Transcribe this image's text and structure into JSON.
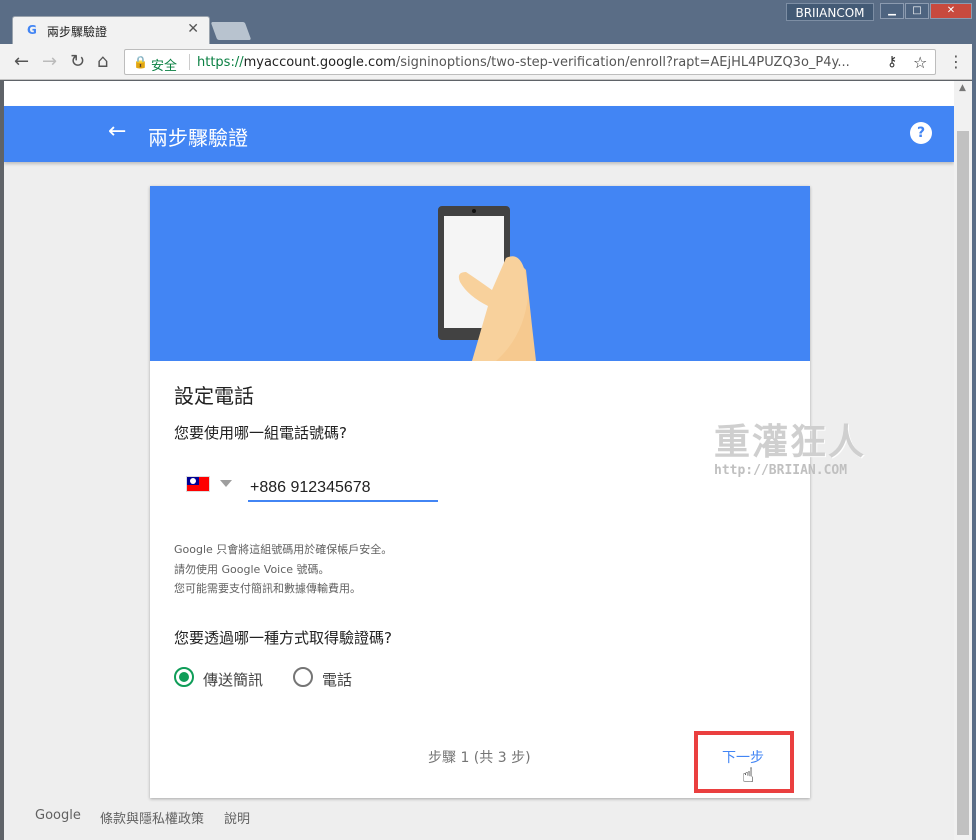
{
  "browser": {
    "tab_title": "兩步驟驗證",
    "tab_icon": "G",
    "user_badge": "BRIIANCOM",
    "secure_label": "安全",
    "url_scheme": "https://",
    "url_host": "myaccount.google.com",
    "url_path": "/signinoptions/two-step-verification/enroll?rapt=AEjHL4PUZQ3o_P4y..."
  },
  "appbar": {
    "title": "兩步驟驗證",
    "help": "?"
  },
  "form": {
    "section_title": "設定電話",
    "question_phone": "您要使用哪一組電話號碼?",
    "phone_value": "+886 912345678",
    "notes": [
      "Google 只會將這組號碼用於確保帳戶安全。",
      "請勿使用 Google Voice 號碼。",
      "您可能需要支付簡訊和數據傳輸費用。"
    ],
    "question_method": "您要透過哪一種方式取得驗證碼?",
    "options": [
      {
        "label": "傳送簡訊",
        "checked": true
      },
      {
        "label": "電話",
        "checked": false
      }
    ],
    "step_text": "步驟 1 (共 3 步)",
    "next_label": "下一步"
  },
  "watermark": {
    "text": "重灌狂人",
    "url": "http://BRIIAN.COM"
  },
  "footer": {
    "links": [
      "Google",
      "條款與隱私權政策",
      "說明"
    ]
  },
  "colors": {
    "primary": "#4285f4",
    "radio": "#0f9d58",
    "highlight": "#ea3f3f"
  }
}
